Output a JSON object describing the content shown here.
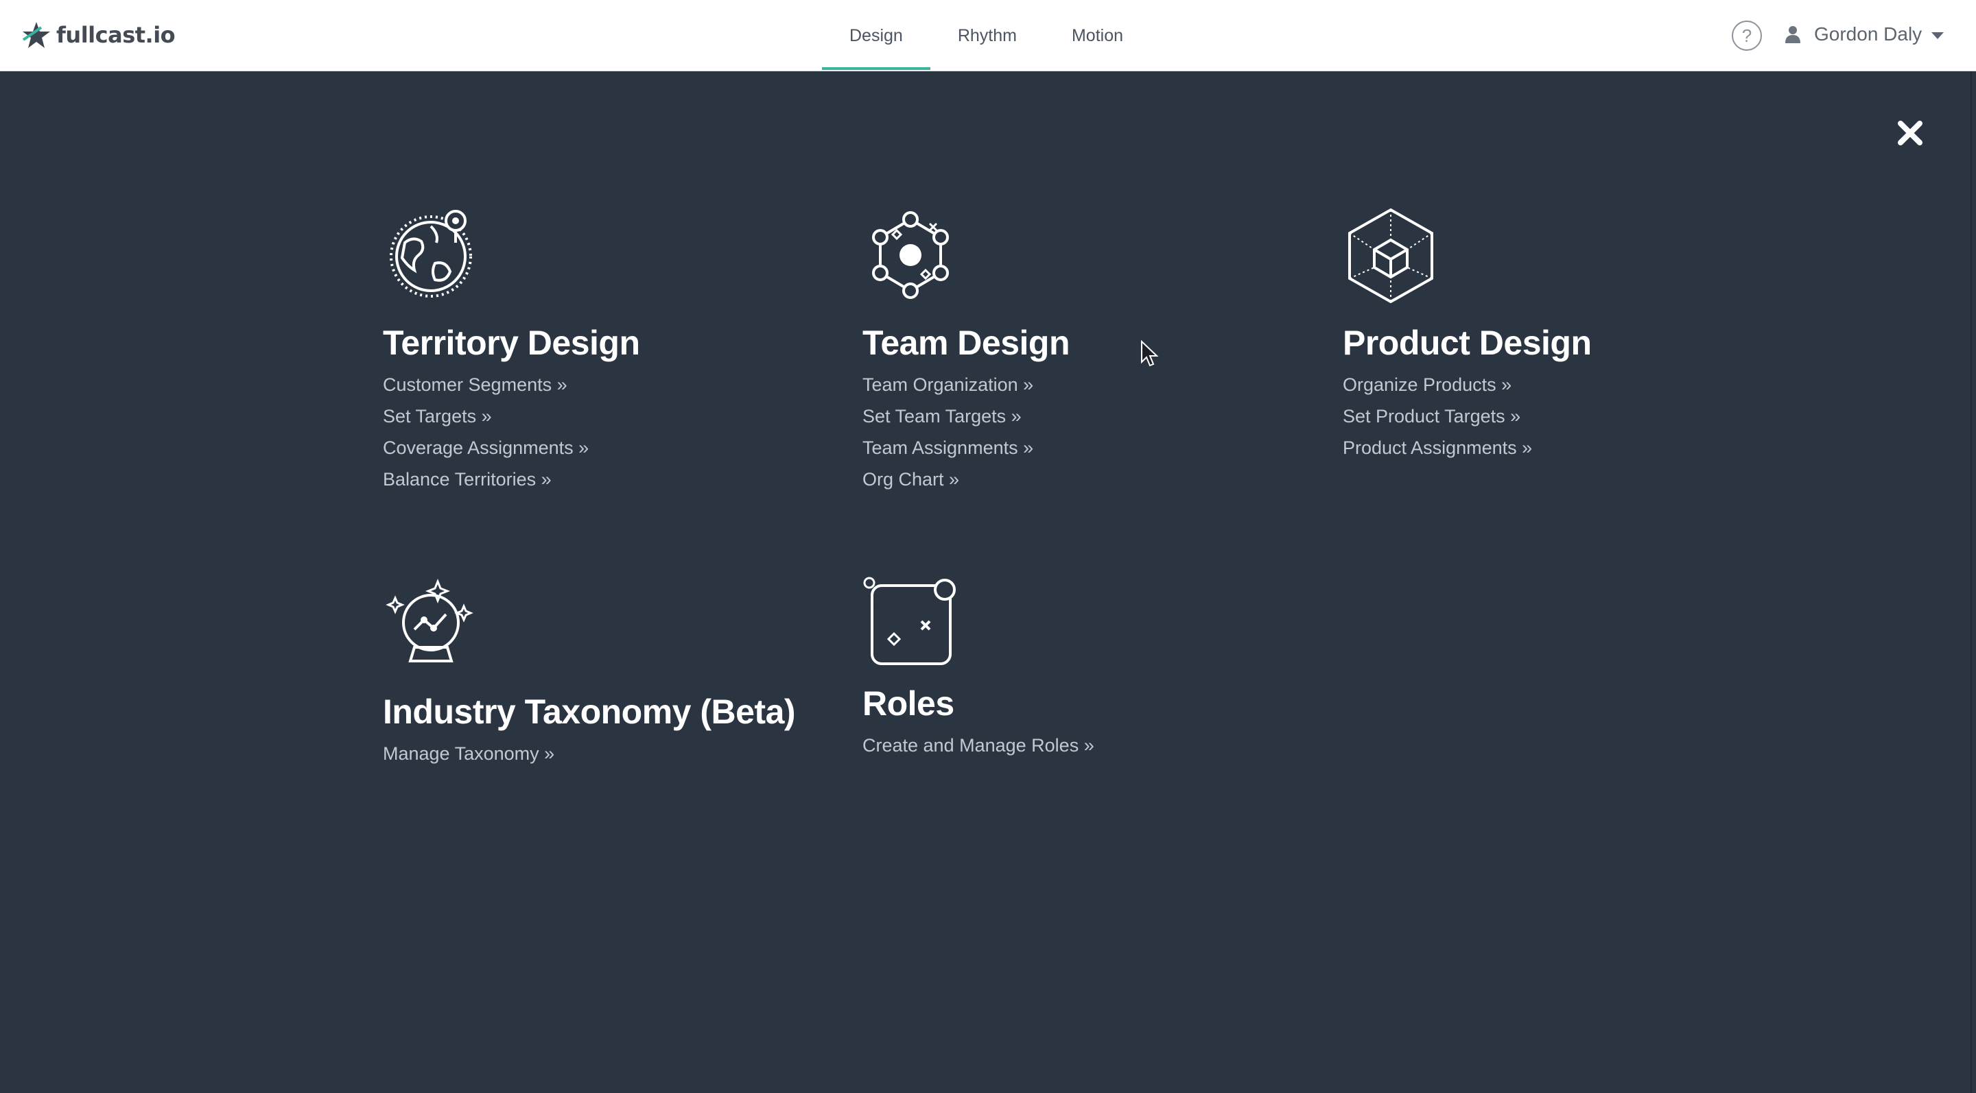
{
  "header": {
    "logo_text": "fullcast.io",
    "tabs": [
      {
        "label": "Design",
        "active": true
      },
      {
        "label": "Rhythm",
        "active": false
      },
      {
        "label": "Motion",
        "active": false
      }
    ],
    "help_label": "?",
    "user_name": "Gordon Daly",
    "icons": {
      "logo": "star-logo-icon",
      "help": "question-circle-icon",
      "user": "user-icon",
      "dropdown": "caret-down-icon"
    }
  },
  "overlay": {
    "close_icon": "close-icon",
    "background_color": "#2b3542",
    "accent_color": "#3bb39f",
    "sections": [
      {
        "title": "Territory Design",
        "icon": "globe-pin-icon",
        "links": [
          "Customer Segments »",
          "Set Targets »",
          "Coverage Assignments »",
          "Balance Territories »"
        ]
      },
      {
        "title": "Team Design",
        "icon": "network-icon",
        "links": [
          "Team Organization »",
          "Set Team Targets »",
          "Team Assignments »",
          "Org Chart »"
        ]
      },
      {
        "title": "Product Design",
        "icon": "cube-icon",
        "links": [
          "Organize Products »",
          "Set Product Targets »",
          "Product Assignments »"
        ]
      },
      {
        "title": "Industry Taxonomy (Beta)",
        "icon": "crystal-ball-icon",
        "links": [
          "Manage Taxonomy »"
        ]
      },
      {
        "title": "Roles",
        "icon": "roles-icon",
        "links": [
          "Create and Manage Roles »"
        ]
      }
    ]
  }
}
